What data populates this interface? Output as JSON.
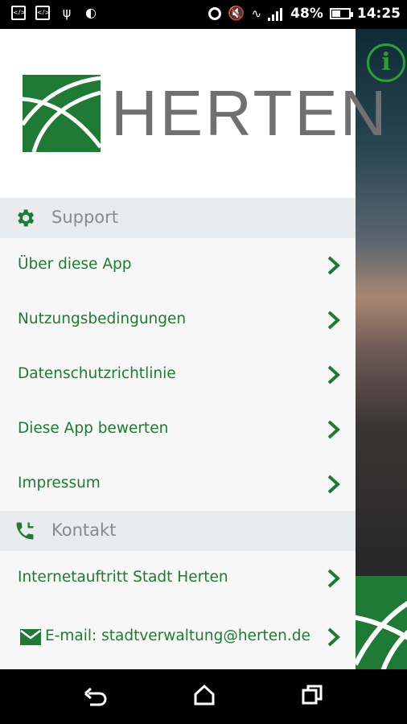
{
  "status_bar": {
    "battery": "48%",
    "time": "14:25"
  },
  "drawer": {
    "logo_text": "HERTEN",
    "sections": [
      {
        "title": "Support",
        "icon": "gear-icon",
        "items": [
          "Über diese App",
          "Nutzungsbedingungen",
          "Datenschutzrichtlinie",
          "Diese App bewerten",
          "Impressum"
        ]
      },
      {
        "title": "Kontakt",
        "icon": "phone-icon",
        "items": [
          "Internetauftritt Stadt Herten",
          "E-mail: stadtverwaltung@herten.de"
        ]
      }
    ]
  },
  "colors": {
    "brand_green": "#1e7a34",
    "accent_green": "#2aa032",
    "section_bg": "#e9ecee"
  }
}
